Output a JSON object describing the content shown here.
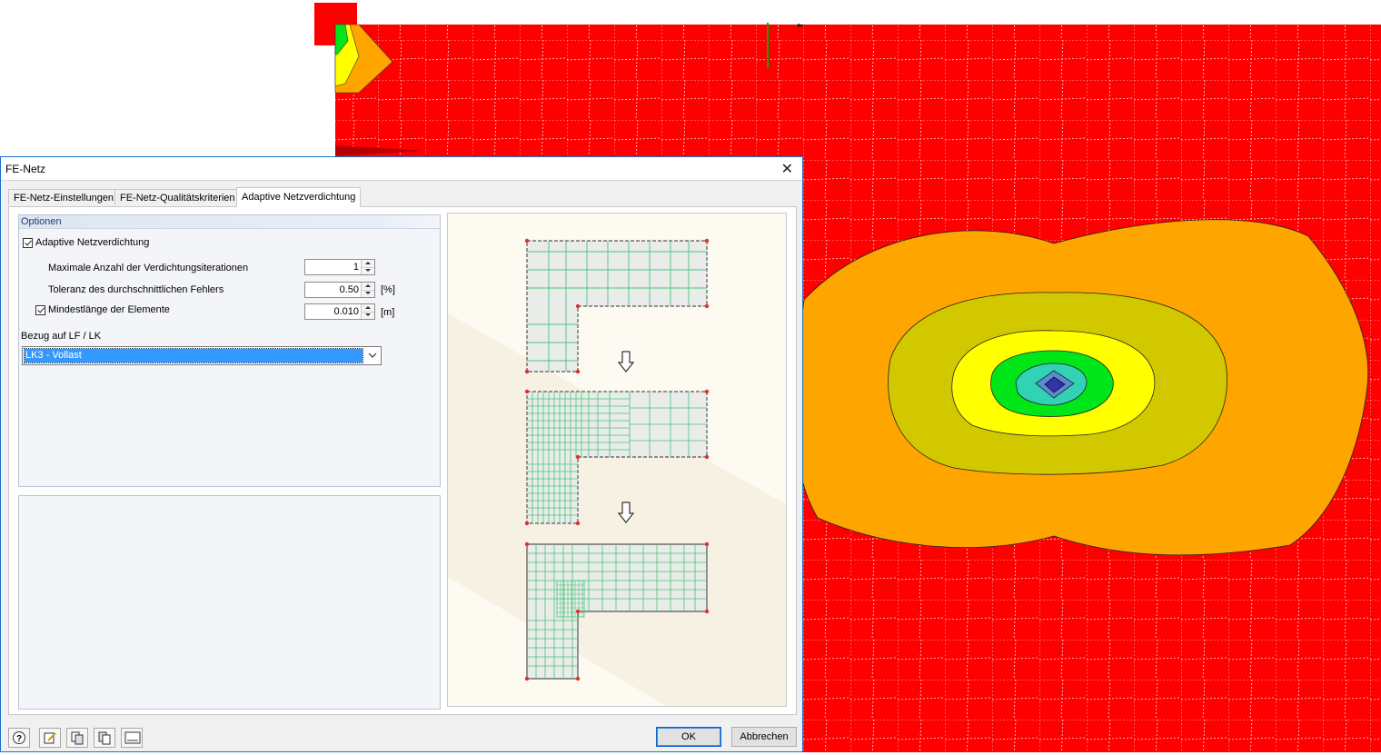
{
  "window": {
    "title": "FE-Netz",
    "close_glyph": "✕"
  },
  "tabs": [
    {
      "label": "FE-Netz-Einstellungen",
      "active": false
    },
    {
      "label": "FE-Netz-Qualitätskriterien",
      "active": false
    },
    {
      "label": "Adaptive Netzverdichtung",
      "active": true
    }
  ],
  "options": {
    "header": "Optionen",
    "adaptive": {
      "label": "Adaptive Netzverdichtung",
      "checked": true
    },
    "max_iterations": {
      "label": "Maximale Anzahl der Verdichtungsiterationen",
      "value": "1",
      "unit": ""
    },
    "tolerance": {
      "label": "Toleranz des durchschnittlichen Fehlers",
      "value": "0.50",
      "unit": "[%]"
    },
    "min_length": {
      "label": "Mindestlänge der Elemente",
      "value": "0.010",
      "unit": "[m]",
      "checked": true
    },
    "reference_label": "Bezug auf LF / LK",
    "reference_value": "LK3 - Vollast"
  },
  "buttons": {
    "ok": "OK",
    "cancel": "Abbrechen"
  },
  "toolbar_icons": [
    "help-icon",
    "edit-icon",
    "copy-settings-icon",
    "paste-settings-icon",
    "numeric-values-icon"
  ],
  "colors": {
    "contour_max": "#ff0000",
    "contour_orange": "#ffa500",
    "contour_olive": "#d2c800",
    "contour_yellow": "#ffff00",
    "contour_green": "#00e619",
    "contour_cyan": "#32d2b4",
    "contour_min": "#3232aa",
    "accent": "#0078d7"
  }
}
